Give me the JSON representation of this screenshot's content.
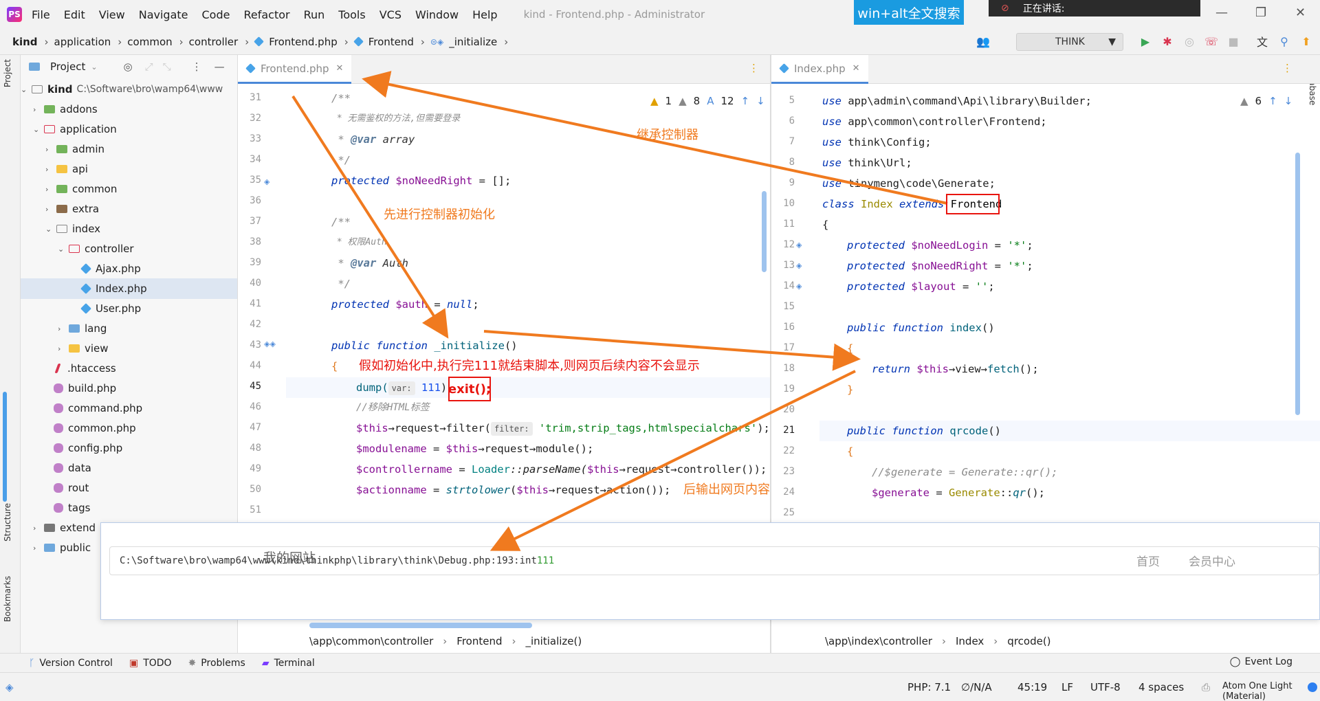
{
  "menubar": {
    "items": [
      "File",
      "Edit",
      "View",
      "Navigate",
      "Code",
      "Refactor",
      "Run",
      "Tools",
      "VCS",
      "Window",
      "Help"
    ],
    "window_title": "kind - Frontend.php - Administrator",
    "search_banner": "win+alt全文搜索",
    "meeting_status": "正在讲话:"
  },
  "navbar": {
    "crumbs": [
      "kind",
      "application",
      "common",
      "controller",
      "Frontend.php",
      "Frontend",
      "_initialize"
    ],
    "run_config": "THINK"
  },
  "left_strip": {
    "project": "Project",
    "structure": "Structure",
    "bookmarks": "Bookmarks"
  },
  "right_strip": {
    "database": "Database"
  },
  "project": {
    "header": "Project",
    "root_name": "kind",
    "root_path": "C:\\Software\\bro\\wamp64\\www",
    "items": [
      {
        "label": "addons"
      },
      {
        "label": "application"
      },
      {
        "label": "admin"
      },
      {
        "label": "api"
      },
      {
        "label": "common"
      },
      {
        "label": "extra"
      },
      {
        "label": "index"
      },
      {
        "label": "controller"
      },
      {
        "label": "Ajax.php"
      },
      {
        "label": "Index.php"
      },
      {
        "label": "User.php"
      },
      {
        "label": "lang"
      },
      {
        "label": "view"
      },
      {
        "label": ".htaccess"
      },
      {
        "label": "build.php"
      },
      {
        "label": "command.php"
      },
      {
        "label": "common.php"
      },
      {
        "label": "config.php"
      },
      {
        "label": "data"
      },
      {
        "label": "rout"
      },
      {
        "label": "tags"
      },
      {
        "label": "extend"
      },
      {
        "label": "public"
      }
    ]
  },
  "left_editor": {
    "tab": "Frontend.php",
    "inspections": {
      "warnings": "1",
      "weak": "8",
      "typos": "12"
    },
    "line_numbers": [
      "31",
      "32",
      "33",
      "34",
      "35",
      "36",
      "37",
      "38",
      "39",
      "40",
      "41",
      "42",
      "43",
      "44",
      "45",
      "46",
      "47",
      "48",
      "49",
      "50",
      "51"
    ],
    "lines": {
      "l31": "/**",
      "l32": " * 无需鉴权的方法,但需要登录",
      "l33_tag": "@var",
      "l33_type": " array",
      "l34": " */",
      "l35_kw": "protected",
      "l35_var": " $noNeedRight",
      "l35_rest": " = [];",
      "l37": "/**",
      "l38": " * 权限Auth",
      "l39_tag": "@var",
      "l39_type": " Auth",
      "l40": " */",
      "l41_kw": "protected",
      "l41_var": " $auth",
      "l41_eq": " = ",
      "l41_null": "null",
      "l41_end": ";",
      "l43_kw": "public function",
      "l43_fn": " _initialize",
      "l43_end": "()",
      "l44": "{",
      "l45_fn": "dump(",
      "l45_hint": "var:",
      "l45_num": " 111",
      "l45_end": ");",
      "l46": "//移除HTML标签",
      "l47_var": "$this",
      "l47_a": "→request→filter(",
      "l47_hint": "filter:",
      "l47_str": " 'trim,strip_tags,htmlspecialchars'",
      "l47_end": ");",
      "l48_var": "$modulename",
      "l48_eq": " = ",
      "l48_this": "$this",
      "l48_rest": "→request→module();",
      "l49_var": "$controllername",
      "l49_eq": " = ",
      "l49_cls": "Loader",
      "l49_rest": "::parseName(",
      "l49_this": "$this",
      "l49_end": "→request→controller());",
      "l50_var": "$actionname",
      "l50_eq": " = ",
      "l50_fn": "strtolower",
      "l50_open": "(",
      "l50_this": "$this",
      "l50_end": "→request→action());"
    },
    "breadcrumb": [
      "\\app\\common\\controller",
      "Frontend",
      "_initialize()"
    ]
  },
  "right_editor": {
    "tab": "Index.php",
    "inspections": {
      "warnings": "6"
    },
    "line_numbers": [
      "5",
      "6",
      "7",
      "8",
      "9",
      "10",
      "11",
      "12",
      "13",
      "14",
      "15",
      "16",
      "17",
      "18",
      "19",
      "20",
      "21",
      "22",
      "23",
      "24",
      "25"
    ],
    "lines": {
      "l5_kw": "use",
      "l5_rest": " app\\admin\\command\\Api\\library\\Builder;",
      "l6_kw": "use",
      "l6_rest": " app\\common\\controller\\Frontend;",
      "l7_kw": "use",
      "l7_rest": " think\\Config;",
      "l8_kw": "use",
      "l8_rest": " think\\Url;",
      "l9_kw": "use",
      "l9_rest": " tinymeng\\code\\Generate;",
      "l10_kw": "class",
      "l10_cls": " Index",
      "l10_ext": " extends",
      "l10_parent": "Frontend",
      "l11": "{",
      "l12_kw": "protected",
      "l12_var": " $noNeedLogin",
      "l12_eq": " = ",
      "l12_str": "'*'",
      "l12_end": ";",
      "l13_kw": "protected",
      "l13_var": " $noNeedRight",
      "l13_eq": " = ",
      "l13_str": "'*'",
      "l13_end": ";",
      "l14_kw": "protected",
      "l14_var": " $layout",
      "l14_eq": " = ",
      "l14_str": "''",
      "l14_end": ";",
      "l16_kw": "public function",
      "l16_fn": " index",
      "l16_end": "()",
      "l17": "{",
      "l18_kw": "return",
      "l18_this": " $this",
      "l18_a": "→view→",
      "l18_fn": "fetch",
      "l18_end": "();",
      "l19": "}",
      "l21_kw": "public function",
      "l21_fn": " qrcode",
      "l21_end": "()",
      "l22": "{",
      "l23": "//$generate = Generate::qr();",
      "l24_var": "$generate",
      "l24_eq": " = ",
      "l24_cls": "Generate",
      "l24_rest": "::",
      "l24_fn": "qr",
      "l24_end": "();"
    },
    "breadcrumb": [
      "\\app\\index\\controller",
      "Index",
      "qrcode()"
    ]
  },
  "overlay": {
    "path_text": "C:\\Software\\bro\\wamp64\\www\\kind\\thinkphp\\library\\think\\Debug.php:193:int ",
    "path_value": "111",
    "site_name": "我的网站",
    "links": [
      "首页",
      "会员中心"
    ]
  },
  "annotations": {
    "inherit": "继承控制器",
    "init_first": "先进行控制器初始化",
    "exit_note": "假如初始化中,执行完111就结束脚本,则网页后续内容不会显示",
    "exit_code": "exit();",
    "output_after": "后输出网页内容"
  },
  "toolbar_bottom": {
    "items": [
      "Version Control",
      "TODO",
      "Problems",
      "Terminal"
    ],
    "event_log": "Event Log"
  },
  "status": {
    "php": "PHP: 7.1",
    "vcs": "∅/N/A",
    "position": "45:19",
    "line_sep": "LF",
    "encoding": "UTF-8",
    "indent": "4 spaces",
    "theme": "Atom One Light (Material)"
  },
  "colors": {
    "annotation_orange": "#f07a1f",
    "annotation_red": "#e8140e",
    "accent_blue": "#4a88d8",
    "search_banner": "#1a9be0"
  }
}
